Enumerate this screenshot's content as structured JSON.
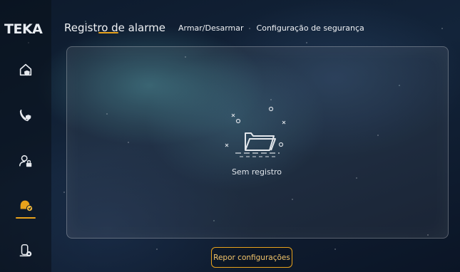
{
  "brand": {
    "logo_text": "TEKA"
  },
  "sidebar": {
    "items": [
      {
        "icon": "home-shield-icon",
        "active": false
      },
      {
        "icon": "phone-shield-icon",
        "active": false
      },
      {
        "icon": "user-lock-icon",
        "active": false
      },
      {
        "icon": "alarm-bell-icon",
        "active": true
      },
      {
        "icon": "device-settings-icon",
        "active": false
      }
    ]
  },
  "tabs": [
    {
      "label": "Registro de alarme",
      "active": true
    },
    {
      "label": "Armar/Desarmar",
      "active": false
    },
    {
      "label": "Configuração de segurança",
      "active": false
    }
  ],
  "panel": {
    "empty_icon": "empty-folder-icon",
    "empty_text": "Sem registro"
  },
  "reset_button": {
    "label": "Repor configurações"
  },
  "colors": {
    "accent": "#e8a21b",
    "text": "#ffffff",
    "background": "#0d1a2c"
  }
}
